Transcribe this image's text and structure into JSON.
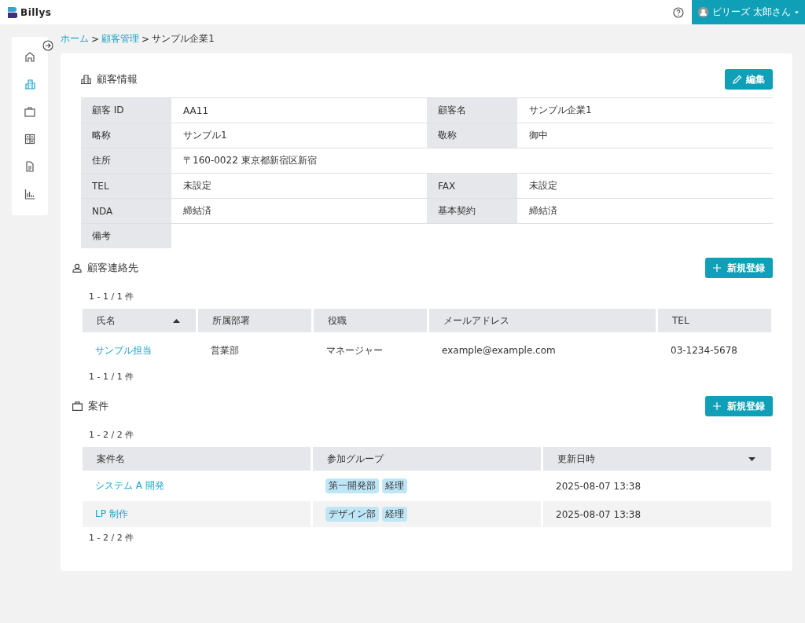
{
  "header": {
    "logo": "Billys",
    "user": "ビリーズ 太郎さん"
  },
  "sidebar": {
    "items": [
      {
        "kind": "home",
        "selected": false
      },
      {
        "kind": "building",
        "selected": true
      },
      {
        "kind": "briefcase",
        "selected": false
      },
      {
        "kind": "calculator",
        "selected": false
      },
      {
        "kind": "document",
        "selected": false
      },
      {
        "kind": "chart",
        "selected": false
      }
    ]
  },
  "breadcrumb_separator": ">",
  "breadcrumb": [
    {
      "label": "ホーム",
      "link": true
    },
    {
      "label": "顧客管理",
      "link": true
    },
    {
      "label": "サンプル企業1",
      "link": false
    }
  ],
  "customer_info": {
    "title": "顧客情報",
    "edit_button": "編集",
    "rows": [
      {
        "cells": [
          {
            "label": "顧客 ID",
            "value": "AA11"
          },
          {
            "label": "顧客名",
            "value": "サンプル企業1"
          }
        ]
      },
      {
        "cells": [
          {
            "label": "略称",
            "value": "サンプル1"
          },
          {
            "label": "敬称",
            "value": "御中"
          }
        ]
      },
      {
        "cells": [
          {
            "label": "住所",
            "value": "〒160-0022 東京都新宿区新宿"
          }
        ]
      },
      {
        "cells": [
          {
            "label": "TEL",
            "value": "未設定"
          },
          {
            "label": "FAX",
            "value": "未設定"
          }
        ]
      },
      {
        "cells": [
          {
            "label": "NDA",
            "value": "締結済"
          },
          {
            "label": "基本契約",
            "value": "締結済"
          }
        ]
      },
      {
        "cells": [
          {
            "label": "備考"
          }
        ]
      }
    ]
  },
  "contacts": {
    "title": "顧客連絡先",
    "new_button": "新規登録",
    "count_top": "1 - 1 / 1 件",
    "count_bottom": "1 - 1 / 1 件",
    "columns": [
      {
        "label": "氏名",
        "sorted": true,
        "ascending": true
      },
      {
        "label": "所属部署",
        "sorted": false
      },
      {
        "label": "役職",
        "sorted": false
      },
      {
        "label": "メールアドレス",
        "sorted": false
      },
      {
        "label": "TEL",
        "sorted": false
      }
    ],
    "rows": [
      {
        "name": "サンプル担当",
        "department": "営業部",
        "position": "マネージャー",
        "email": "example@example.com",
        "tel": "03-1234-5678"
      }
    ]
  },
  "projects": {
    "title": "案件",
    "new_button": "新規登録",
    "count_top": "1 - 2 / 2 件",
    "count_bottom": "1 - 2 / 2 件",
    "columns": [
      {
        "label": "案件名",
        "sorted": false
      },
      {
        "label": "参加グループ",
        "sorted": false
      },
      {
        "label": "更新日時",
        "sorted": true,
        "ascending": false
      }
    ],
    "rows": [
      {
        "name": "システム A 開発",
        "groups": [
          "第一開発部",
          "経理"
        ],
        "updated": "2025-08-07 13:38"
      },
      {
        "name": "LP 制作",
        "groups": [
          "デザイン部",
          "経理"
        ],
        "updated": "2025-08-07 13:38"
      }
    ]
  }
}
